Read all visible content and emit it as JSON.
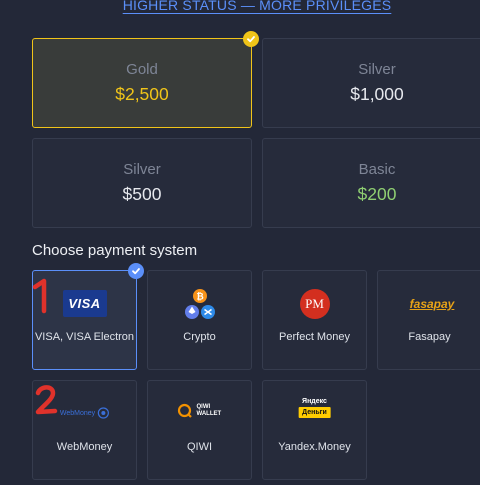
{
  "header": {
    "link_text": "HIGHER STATUS — MORE PRIVILEGES"
  },
  "plans": [
    {
      "name": "Gold",
      "amount": "$2,500"
    },
    {
      "name": "Silver",
      "amount": "$1,000"
    },
    {
      "name": "Silver",
      "amount": "$500"
    },
    {
      "name": "Basic",
      "amount": "$200"
    }
  ],
  "payment": {
    "title": "Choose payment system",
    "methods": [
      {
        "label": "VISA, VISA Electron",
        "logo_text": "VISA"
      },
      {
        "label": "Crypto"
      },
      {
        "label": "Perfect Money",
        "logo_text": "PM"
      },
      {
        "label": "Fasapay",
        "logo_text": "fasapay"
      },
      {
        "label": "WebMoney",
        "logo_text": "WebMoney"
      },
      {
        "label": "QIWI",
        "logo_text": "QIWI WALLET"
      },
      {
        "label": "Yandex.Money",
        "logo_text": "Яндекс",
        "logo_text2": "Деньги"
      }
    ]
  },
  "annotations": {
    "one": "1",
    "two": "2"
  },
  "colors": {
    "accent": "#5b8ff9",
    "gold": "#f0c419",
    "green": "#8fcf72",
    "background": "#232838"
  }
}
